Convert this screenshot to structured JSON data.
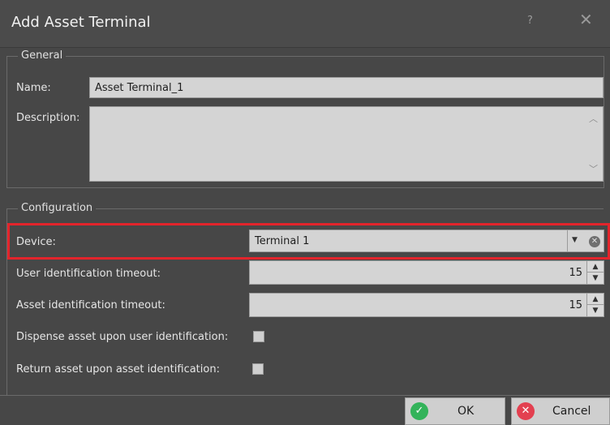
{
  "window": {
    "title": "Add Asset Terminal",
    "help_label": "?",
    "close_label": "✕"
  },
  "general": {
    "title": "General",
    "name_label": "Name:",
    "name_value": "Asset Terminal_1",
    "description_label": "Description:",
    "description_value": ""
  },
  "configuration": {
    "title": "Configuration",
    "device_label": "Device:",
    "device_value": "Terminal 1",
    "user_timeout_label": "User identification timeout:",
    "user_timeout_value": "15",
    "asset_timeout_label": "Asset identification timeout:",
    "asset_timeout_value": "15",
    "dispense_label": "Dispense asset upon user identification:",
    "dispense_checked": false,
    "return_label": "Return asset upon asset identification:",
    "return_checked": false
  },
  "buttons": {
    "ok_label": "OK",
    "cancel_label": "Cancel"
  },
  "colors": {
    "highlight": "#e3242b",
    "ok": "#33b35a",
    "cancel": "#e34050"
  }
}
